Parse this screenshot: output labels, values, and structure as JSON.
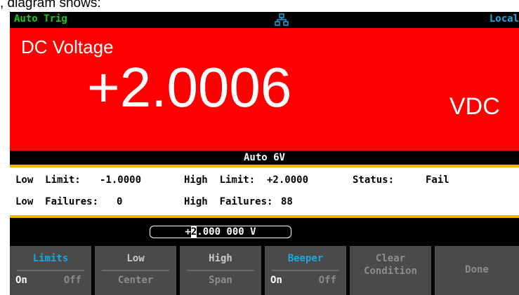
{
  "caption": ", diagram shows:",
  "status_bar": {
    "trigger": "Auto Trig",
    "network_icon": "network-icon",
    "remote": "Local"
  },
  "measurement": {
    "function": "DC Voltage",
    "value": "+2.0006",
    "unit": "VDC",
    "range": "Auto 6V",
    "color": "#ff0000"
  },
  "limits": {
    "low_limit_label": "Low  Limit:",
    "low_limit_value": "-1.0000",
    "high_limit_label": "High  Limit:",
    "high_limit_value": "+2.0000",
    "status_label": "Status:",
    "status_value": "Fail",
    "low_failures_label": "Low  Failures:",
    "low_failures_value": "0",
    "high_failures_label": "High  Failures:",
    "high_failures_value": "88"
  },
  "entry": {
    "prefix": "+",
    "cursor_char": "2",
    "rest": ".000 000  V"
  },
  "softkeys": [
    {
      "top": "Limits",
      "on": "On",
      "off": "Off"
    },
    {
      "top": "Low",
      "bottom": "Center"
    },
    {
      "top": "High",
      "bottom": "Span"
    },
    {
      "top": "Beeper",
      "on": "On",
      "off": "Off"
    },
    {
      "top": "Clear",
      "bottom": "Condition"
    },
    {
      "top": "Done"
    }
  ]
}
